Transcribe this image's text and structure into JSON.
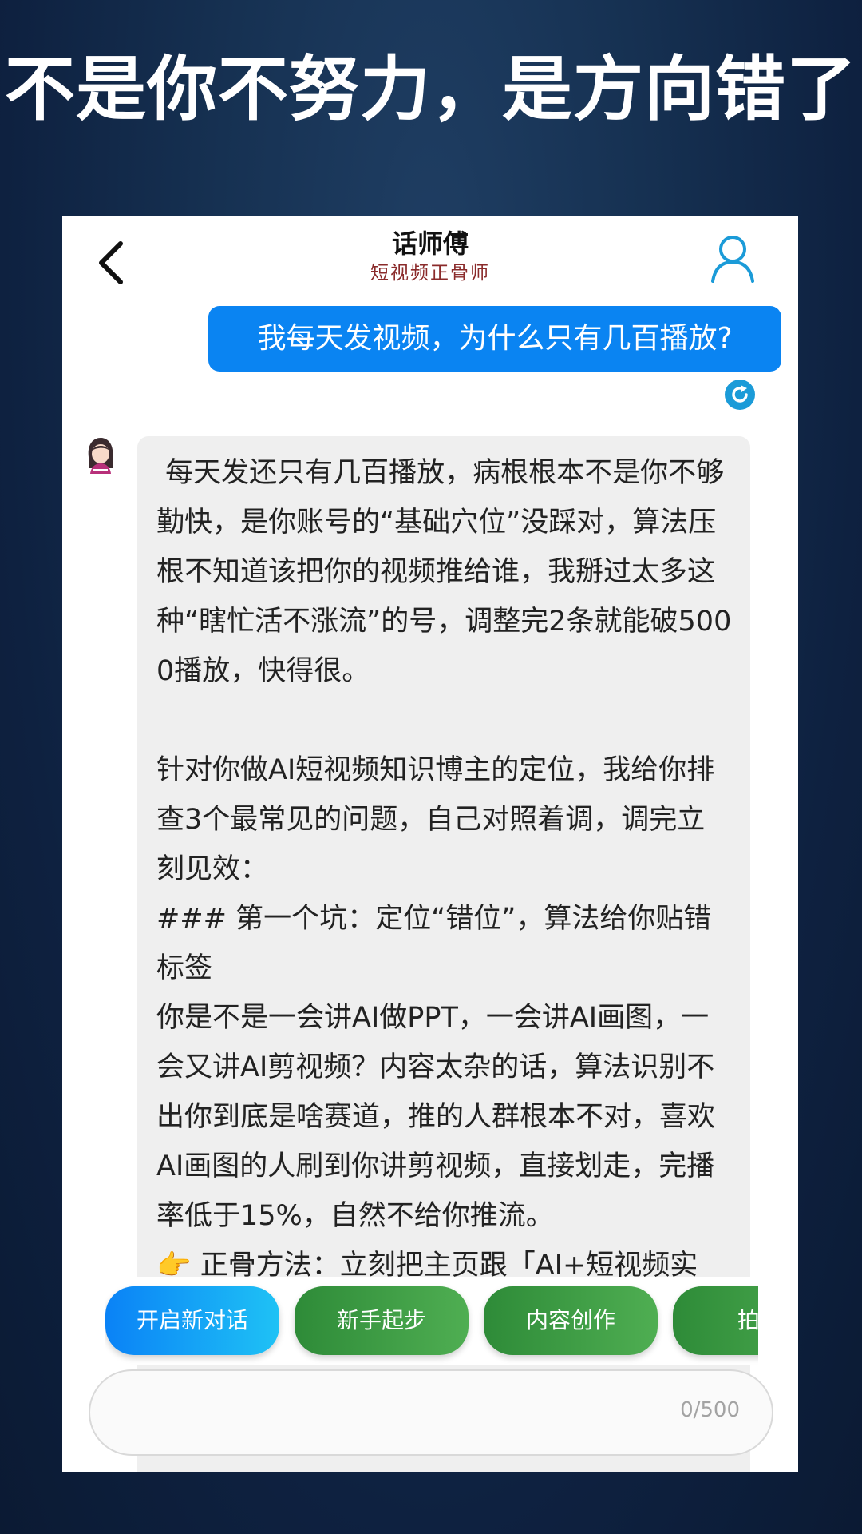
{
  "headline": "不是你不努力，是方向错了",
  "header": {
    "title": "话师傅",
    "subtitle": "短视频正骨师"
  },
  "user_message": "我每天发视频，为什么只有几百播放?",
  "ai_message": " 每天发还只有几百播放，病根根本不是你不够勤快，是你账号的“基础穴位”没踩对，算法压根不知道该把你的视频推给谁，我掰过太多这种“瞎忙活不涨流”的号，调整完2条就能破5000播放，快得很。\n\n针对你做AI短视频知识博主的定位，我给你排查3个最常见的问题，自己对照着调，调完立刻见效：\n### 第一个坑：定位“错位”，算法给你贴错标签\n你是不是一会讲AI做PPT，一会讲AI画图，一会又讲AI剪视频？内容太杂的话，算法识别不出你到底是啥赛道，推的人群根本不对，喜欢AI画图的人刷到你讲剪视频，直接划走，完播率低于15%，自然不给你推流。\n👉 正骨方法：立刻把主页跟「AI+短视频实",
  "quick_actions": [
    "开启新对话",
    "新手起步",
    "内容创作",
    "拍摄"
  ],
  "input": {
    "placeholder": "",
    "value": "",
    "counter": "0/500"
  },
  "icons": {
    "back": "chevron-left-icon",
    "profile": "user-profile-icon",
    "retry": "refresh-icon",
    "avatar": "assistant-avatar"
  },
  "colors": {
    "user_bubble": "#0a84f2",
    "chip_blue": "#0a82f6",
    "chip_green": "#2e8b38",
    "subtitle": "#8a2a2a",
    "icon_blue": "#1b9bd8"
  }
}
